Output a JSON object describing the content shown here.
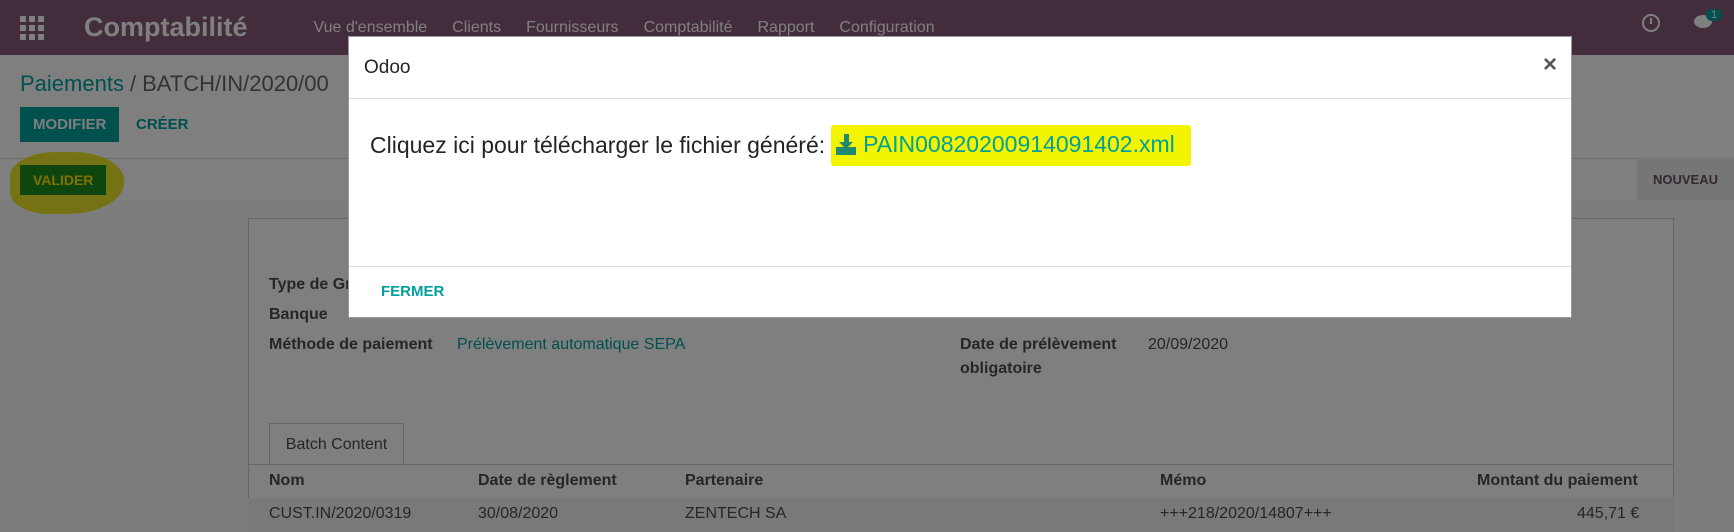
{
  "navbar": {
    "app_title": "Comptabilité",
    "menu": [
      "Vue d'ensemble",
      "Clients",
      "Fournisseurs",
      "Comptabilité",
      "Rapport",
      "Configuration"
    ],
    "chat_badge": "1"
  },
  "breadcrumb": {
    "parent": "Paiements",
    "separator": "/",
    "current": "BATCH/IN/2020/00"
  },
  "buttons": {
    "modifier": "MODIFIER",
    "creer": "CRÉER",
    "valider": "VALIDER",
    "nouveau": "NOUVEAU"
  },
  "form": {
    "left": [
      {
        "label": "Type de Gr",
        "value": ""
      },
      {
        "label": "Banque",
        "value": ""
      },
      {
        "label": "Méthode de paiement",
        "value": "Prélèvement automatique SEPA"
      }
    ],
    "right": [
      {
        "label": "Date de prélèvement",
        "label2": "obligatoire",
        "value": "20/09/2020"
      }
    ]
  },
  "tab": {
    "label": "Batch Content"
  },
  "table": {
    "headers": [
      "Nom",
      "Date de règlement",
      "Partenaire",
      "Mémo",
      "Montant du paiement"
    ],
    "rows": [
      [
        "CUST.IN/2020/0319",
        "30/08/2020",
        "ZENTECH SA",
        "+++218/2020/14807+++",
        "445,71 €"
      ]
    ]
  },
  "modal": {
    "title": "Odoo",
    "close": "×",
    "text": "Cliquez ici pour télécharger le fichier généré:",
    "file_name": "PAIN00820200914091402.xml",
    "close_button": "FERMER"
  }
}
